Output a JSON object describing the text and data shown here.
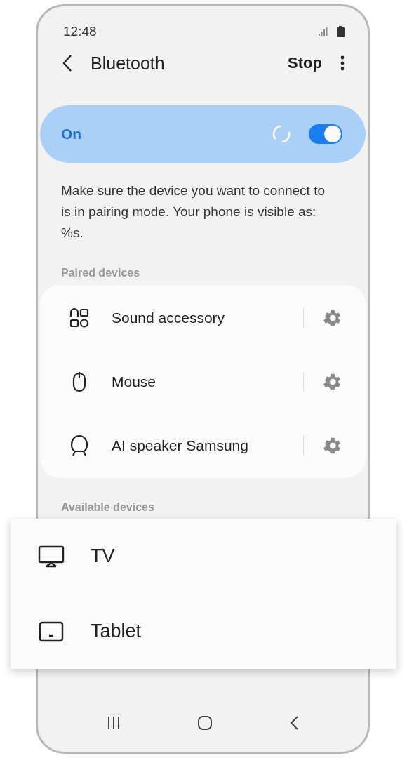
{
  "status_bar": {
    "time": "12:48"
  },
  "header": {
    "title": "Bluetooth",
    "action": "Stop"
  },
  "toggle": {
    "label": "On",
    "on": true
  },
  "description": "Make sure the device you want to connect to is in pairing mode. Your phone is visible as: %s.",
  "paired_section": {
    "title": "Paired devices",
    "devices": [
      {
        "name": "Sound accessory",
        "kind": "sound"
      },
      {
        "name": "Mouse",
        "kind": "mouse"
      },
      {
        "name": "AI speaker Samsung",
        "kind": "speaker"
      }
    ]
  },
  "available_section": {
    "title": "Available devices"
  },
  "available_popup": {
    "devices": [
      {
        "name": "TV",
        "kind": "tv"
      },
      {
        "name": "Tablet",
        "kind": "tablet"
      }
    ]
  }
}
